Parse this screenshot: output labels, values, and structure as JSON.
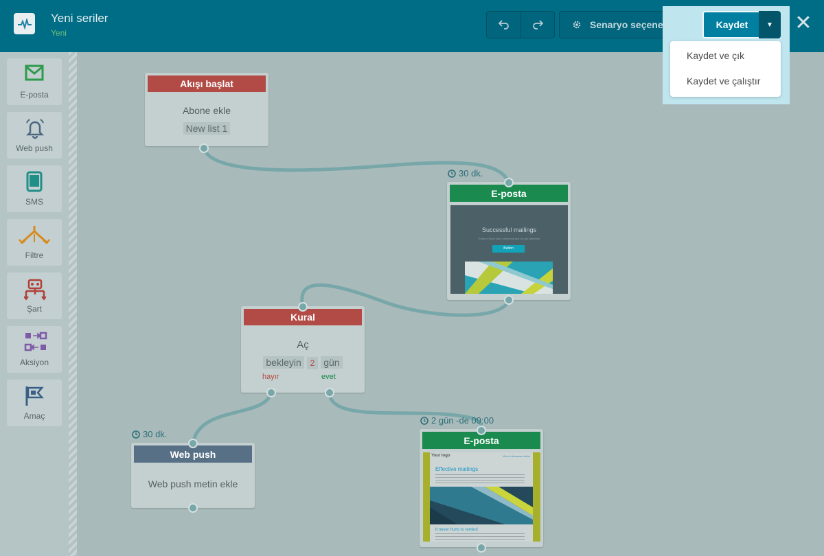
{
  "header": {
    "title": "Yeni seriler",
    "subtitle": "Yeni",
    "options_label": "Senaryo seçenekleri",
    "save_label": "Kaydet",
    "dropdown": [
      "Kaydet ve çık",
      "Kaydet ve çalıştır"
    ]
  },
  "sidebar": {
    "items": [
      {
        "label": "E-posta",
        "icon": "envelope-icon",
        "color": "#2e9a4c"
      },
      {
        "label": "Web push",
        "icon": "bell-icon",
        "color": "#4c6780"
      },
      {
        "label": "SMS",
        "icon": "tablet-icon",
        "color": "#1f8f87"
      },
      {
        "label": "Filtre",
        "icon": "filter-branch-icon",
        "color": "#d88a1c"
      },
      {
        "label": "Şart",
        "icon": "robot-icon",
        "color": "#b0413b"
      },
      {
        "label": "Aksiyon",
        "icon": "action-arrows-icon",
        "color": "#7f5aa8"
      },
      {
        "label": "Amaç",
        "icon": "flag-icon",
        "color": "#3a6086"
      }
    ]
  },
  "nodes": {
    "start": {
      "title": "Akışı başlat",
      "body": "Abone ekle",
      "tag": "New list 1"
    },
    "email1": {
      "title": "E-posta",
      "timer": "30 dk.",
      "preview_title": "Successful mailings",
      "preview_sub": "Keep in touch with customers just as you dreamed",
      "preview_button": "Button"
    },
    "rule": {
      "title": "Kural",
      "body": "Aç",
      "wait_label": "bekleyin",
      "wait_value": "2",
      "wait_unit": "gün",
      "no_label": "hayır",
      "yes_label": "evet"
    },
    "webpush": {
      "title": "Web push",
      "timer": "30 dk.",
      "body": "Web push metin ekle"
    },
    "email2": {
      "title": "E-posta",
      "timer": "2 gün -de 09:00",
      "preview_logo": "Your logo",
      "preview_link": "View in browser online",
      "preview_h1": "Effective mailings",
      "preview_h2": "It never hurts to remind"
    }
  },
  "colors": {
    "header_bg": "#006d86",
    "canvas_bg": "#a9babb",
    "start_red": "#b24b46",
    "email_green": "#1a8a4f",
    "webpush_slate": "#577086",
    "connector": "#78a7a9"
  }
}
